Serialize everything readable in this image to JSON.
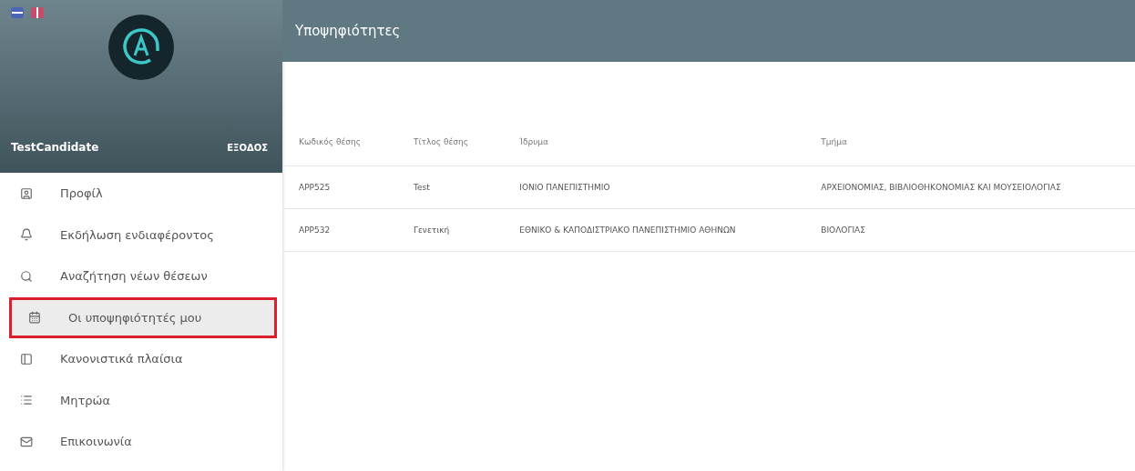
{
  "user": {
    "name": "TestCandidate",
    "logout": "ΕΞΟΔΟΣ"
  },
  "menu": [
    {
      "label": "Προφίλ",
      "kind": "profile",
      "selected": false
    },
    {
      "label": "Εκδήλωση ενδιαφέροντος",
      "kind": "bell",
      "selected": false
    },
    {
      "label": "Αναζήτηση νέων θέσεων",
      "kind": "search",
      "selected": false
    },
    {
      "label": "Οι υποψηφιότητές μου",
      "kind": "calendar",
      "selected": true
    },
    {
      "label": "Κανονιστικά πλαίσια",
      "kind": "frame",
      "selected": false
    },
    {
      "label": "Μητρώα",
      "kind": "list",
      "selected": false
    },
    {
      "label": "Επικοινωνία",
      "kind": "mail",
      "selected": false
    }
  ],
  "page_title": "Υποψηφιότητες",
  "table": {
    "columns": [
      "Κωδικός θέσης",
      "Τίτλος θέσης",
      "Ίδρυμα",
      "Τμήμα"
    ],
    "rows": [
      [
        "APP525",
        "Test",
        "ΙΟΝΙΟ ΠΑΝΕΠΙΣΤΗΜΙΟ",
        "ΑΡΧΕΙΟΝΟΜΙΑΣ, ΒΙΒΛΙΟΘΗΚΟΝΟΜΙΑΣ ΚΑΙ ΜΟΥΣΕΙΟΛΟΓΙΑΣ"
      ],
      [
        "APP532",
        "Γενετική",
        "ΕΘΝΙΚΟ & ΚΑΠΟΔΙΣΤΡΙΑΚΟ ΠΑΝΕΠΙΣΤΗΜΙΟ ΑΘΗΝΩΝ",
        "ΒΙΟΛΟΓΙΑΣ"
      ]
    ]
  }
}
